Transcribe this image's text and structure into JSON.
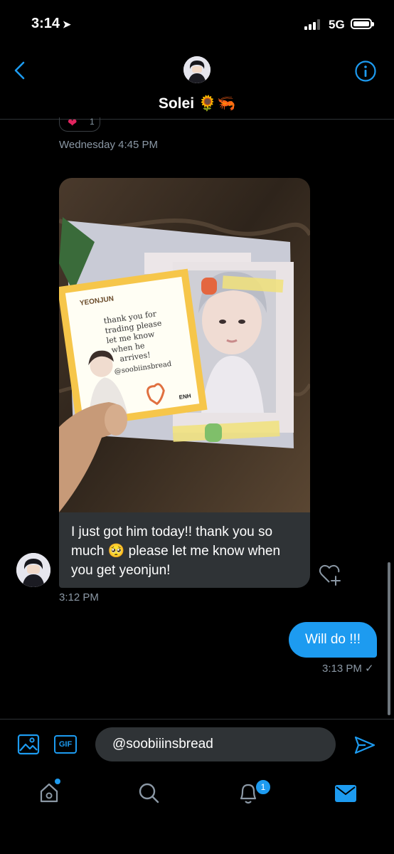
{
  "status_bar": {
    "time": "3:14",
    "network": "5G",
    "signal_bars": 3,
    "battery_level": 0.9
  },
  "header": {
    "name": "Solei 🌻🦐"
  },
  "conversation": {
    "reaction": {
      "emoji": "❤",
      "count": "1"
    },
    "earlier_timestamp": "Wednesday 4:45 PM",
    "received_message": {
      "text": "I just got him today!! thank you so much 🥺 please let me know when you get yeonjun!",
      "timestamp": "3:12 PM",
      "photo_card": {
        "title_label": "YEONJUN",
        "note_text": "thank you for trading please let me know when he arrives! @soobiinsbread",
        "footer_tag": "ENH"
      }
    },
    "sent_message": {
      "text": "Will do !!!",
      "timestamp": "3:13 PM ✓"
    }
  },
  "composer": {
    "value": "@soobiiinsbread",
    "gif_label": "GIF"
  },
  "tab_bar": {
    "notification_count": "1"
  },
  "colors": {
    "accent": "#1d9bf0",
    "bubble_dark": "#2f3336",
    "meta": "#8b98a5"
  }
}
